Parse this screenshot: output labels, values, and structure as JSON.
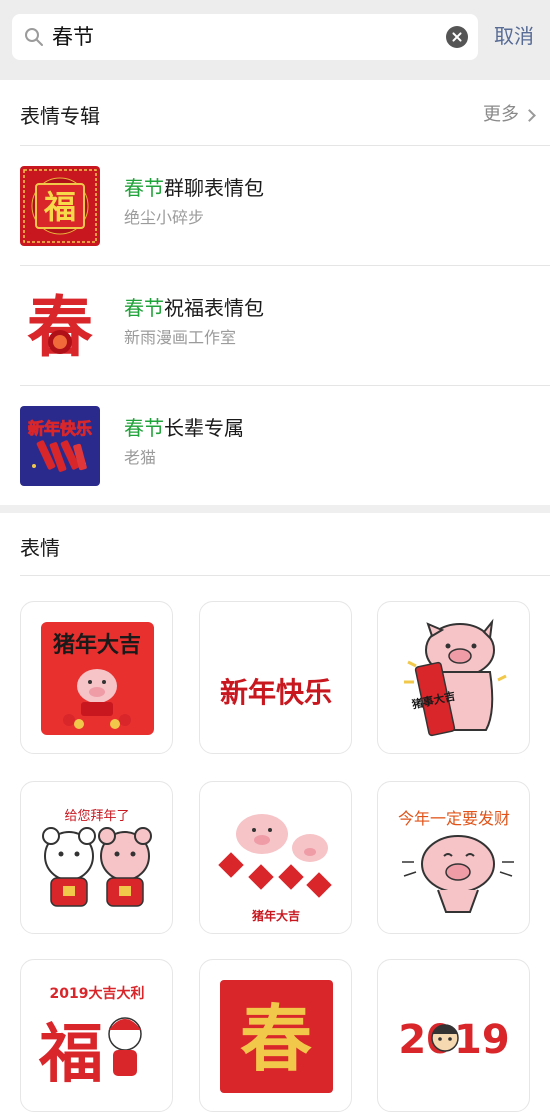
{
  "search": {
    "query": "春节",
    "cancel_label": "取消"
  },
  "albums_section": {
    "title": "表情专辑",
    "more_label": "更多",
    "items": [
      {
        "highlight": "春节",
        "rest": "群聊表情包",
        "author": "绝尘小碎步",
        "thumb_text": "福"
      },
      {
        "highlight": "春节",
        "rest": "祝福表情包",
        "author": "新雨漫画工作室",
        "thumb_text": "春"
      },
      {
        "highlight": "春节",
        "rest": "长辈专属",
        "author": "老猫",
        "thumb_text": "新年快乐"
      }
    ]
  },
  "stickers_section": {
    "title": "表情",
    "stickers": [
      {
        "text": "猪年大吉"
      },
      {
        "text": "新年快乐"
      },
      {
        "text": "猪事大吉"
      },
      {
        "text": "给您拜年了"
      },
      {
        "text": "猪年大吉"
      },
      {
        "text": "今年一定要发财"
      },
      {
        "text": "2019大吉大利",
        "text2": "福"
      },
      {
        "text": "春"
      },
      {
        "text": "2019"
      }
    ]
  },
  "colors": {
    "highlight": "#21a33b",
    "link": "#576b95",
    "festive_red": "#d8262b",
    "gold": "#f2c84b",
    "pig_pink": "#f6c3c7"
  }
}
